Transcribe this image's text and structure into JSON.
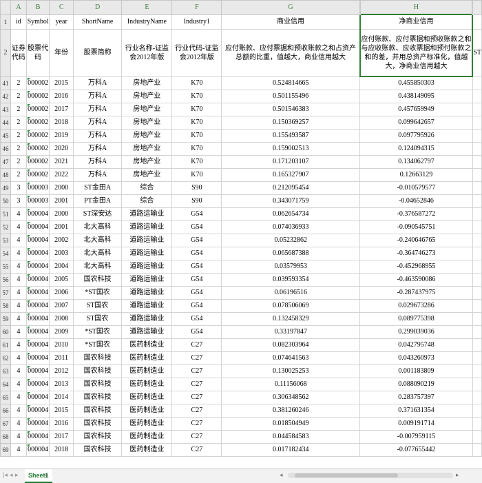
{
  "columns": [
    "A",
    "B",
    "C",
    "D",
    "E",
    "F",
    "G",
    "H"
  ],
  "header1": {
    "rownum": "1",
    "cells": [
      "id",
      "Symbol",
      "year",
      "ShortName",
      "IndustryName",
      "Industry1",
      "商业信用",
      "净商业信用"
    ]
  },
  "header2": {
    "rownum": "2",
    "cells": [
      "证券代码",
      "股票代码",
      "年份",
      "股票简称",
      "行业名称-证监会2012年版",
      "行业代码-证监会2012年版",
      "应付账款、应付票据和预收账款之和占资产总额的比重，值越大，商业信用越大",
      "应付账款、应付票据和预收账款之和与应收账款、应收票据和预付账款之和的差，并用总资产标准化，值越大，净商业信用越大"
    ],
    "overflow": "ST"
  },
  "rows": [
    {
      "n": "41",
      "c": [
        "2",
        "000002",
        "2015",
        "万科A",
        "房地产业",
        "K70",
        "0.524814665",
        "0.455850303"
      ]
    },
    {
      "n": "42",
      "c": [
        "2",
        "000002",
        "2016",
        "万科A",
        "房地产业",
        "K70",
        "0.501155496",
        "0.438149095"
      ]
    },
    {
      "n": "43",
      "c": [
        "2",
        "000002",
        "2017",
        "万科A",
        "房地产业",
        "K70",
        "0.501546383",
        "0.457659949"
      ]
    },
    {
      "n": "44",
      "c": [
        "2",
        "000002",
        "2018",
        "万科A",
        "房地产业",
        "K70",
        "0.150369257",
        "0.099642657"
      ]
    },
    {
      "n": "45",
      "c": [
        "2",
        "000002",
        "2019",
        "万科A",
        "房地产业",
        "K70",
        "0.155493587",
        "0.097795926"
      ]
    },
    {
      "n": "46",
      "c": [
        "2",
        "000002",
        "2020",
        "万科A",
        "房地产业",
        "K70",
        "0.159002513",
        "0.124094315"
      ]
    },
    {
      "n": "47",
      "c": [
        "2",
        "000002",
        "2021",
        "万科A",
        "房地产业",
        "K70",
        "0.171203107",
        "0.134062797"
      ]
    },
    {
      "n": "48",
      "c": [
        "2",
        "000002",
        "2022",
        "万科A",
        "房地产业",
        "K70",
        "0.165327907",
        "0.12663129"
      ]
    },
    {
      "n": "49",
      "c": [
        "3",
        "000003",
        "2000",
        "ST金田A",
        "综合",
        "S90",
        "0.212095454",
        "-0.010579577"
      ]
    },
    {
      "n": "50",
      "c": [
        "3",
        "000003",
        "2001",
        "PT金田A",
        "综合",
        "S90",
        "0.343071759",
        "-0.04652846"
      ]
    },
    {
      "n": "51",
      "c": [
        "4",
        "000004",
        "2000",
        "ST深安达",
        "道路运输业",
        "G54",
        "0.062654734",
        "-0.376587272"
      ]
    },
    {
      "n": "52",
      "c": [
        "4",
        "000004",
        "2001",
        "北大高科",
        "道路运输业",
        "G54",
        "0.074036933",
        "-0.090545751"
      ]
    },
    {
      "n": "53",
      "c": [
        "4",
        "000004",
        "2002",
        "北大高科",
        "道路运输业",
        "G54",
        "0.05232862",
        "-0.240646765"
      ]
    },
    {
      "n": "54",
      "c": [
        "4",
        "000004",
        "2003",
        "北大高科",
        "道路运输业",
        "G54",
        "0.065687388",
        "-0.364746273"
      ]
    },
    {
      "n": "55",
      "c": [
        "4",
        "000004",
        "2004",
        "北大高科",
        "道路运输业",
        "G54",
        "0.03579953",
        "-0.452968955"
      ]
    },
    {
      "n": "56",
      "c": [
        "4",
        "000004",
        "2005",
        "国农科技",
        "道路运输业",
        "G54",
        "0.039593354",
        "-0.463590086"
      ]
    },
    {
      "n": "57",
      "c": [
        "4",
        "000004",
        "2006",
        "*ST国农",
        "道路运输业",
        "G54",
        "0.06196516",
        "-0.287437975"
      ]
    },
    {
      "n": "58",
      "c": [
        "4",
        "000004",
        "2007",
        "ST国农",
        "道路运输业",
        "G54",
        "0.078506069",
        "0.029673286"
      ]
    },
    {
      "n": "59",
      "c": [
        "4",
        "000004",
        "2008",
        "ST国农",
        "道路运输业",
        "G54",
        "0.132458329",
        "0.089775398"
      ]
    },
    {
      "n": "60",
      "c": [
        "4",
        "000004",
        "2009",
        "*ST国农",
        "道路运输业",
        "G54",
        "0.33197847",
        "0.299039036"
      ]
    },
    {
      "n": "61",
      "c": [
        "4",
        "000004",
        "2010",
        "*ST国农",
        "医药制造业",
        "C27",
        "0.082303964",
        "0.042795748"
      ]
    },
    {
      "n": "62",
      "c": [
        "4",
        "000004",
        "2011",
        "国农科技",
        "医药制造业",
        "C27",
        "0.074641563",
        "0.043260973"
      ]
    },
    {
      "n": "63",
      "c": [
        "4",
        "000004",
        "2012",
        "国农科技",
        "医药制造业",
        "C27",
        "0.130025253",
        "0.001183809"
      ]
    },
    {
      "n": "64",
      "c": [
        "4",
        "000004",
        "2013",
        "国农科技",
        "医药制造业",
        "C27",
        "0.11156068",
        "0.088090219"
      ]
    },
    {
      "n": "65",
      "c": [
        "4",
        "000004",
        "2014",
        "国农科技",
        "医药制造业",
        "C27",
        "0.306348562",
        "0.283757397"
      ]
    },
    {
      "n": "66",
      "c": [
        "4",
        "000004",
        "2015",
        "国农科技",
        "医药制造业",
        "C27",
        "0.381260246",
        "0.371631354"
      ]
    },
    {
      "n": "67",
      "c": [
        "4",
        "000004",
        "2016",
        "国农科技",
        "医药制造业",
        "C27",
        "0.018504949",
        "0.009191714"
      ]
    },
    {
      "n": "68",
      "c": [
        "4",
        "000004",
        "2017",
        "国农科技",
        "医药制造业",
        "C27",
        "0.044584583",
        "-0.007959115"
      ]
    },
    {
      "n": "69",
      "c": [
        "4",
        "000004",
        "2018",
        "国农科技",
        "医药制造业",
        "C27",
        "0.017182434",
        "-0.077655442"
      ]
    }
  ],
  "sheet_tab": "Sheet1",
  "add_tab_icon": "plus-icon"
}
